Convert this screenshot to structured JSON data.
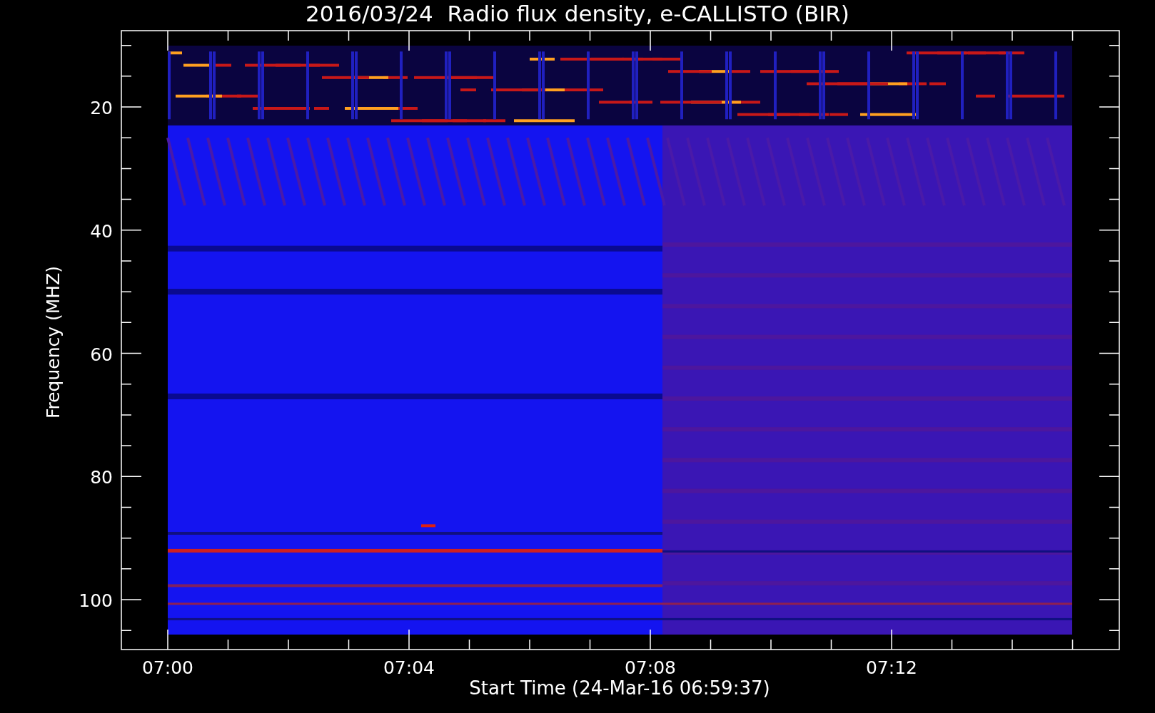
{
  "chart": {
    "title": "2016/03/24  Radio flux density, e-CALLISTO (BIR)",
    "xlabel": "Start Time (24-Mar-16 06:59:37)",
    "ylabel": "Frequency (MHZ)",
    "ytick_labels": [
      "20",
      "40",
      "60",
      "80",
      "100"
    ],
    "xtick_labels": [
      "07:00",
      "07:04",
      "07:08",
      "07:12"
    ]
  }
}
